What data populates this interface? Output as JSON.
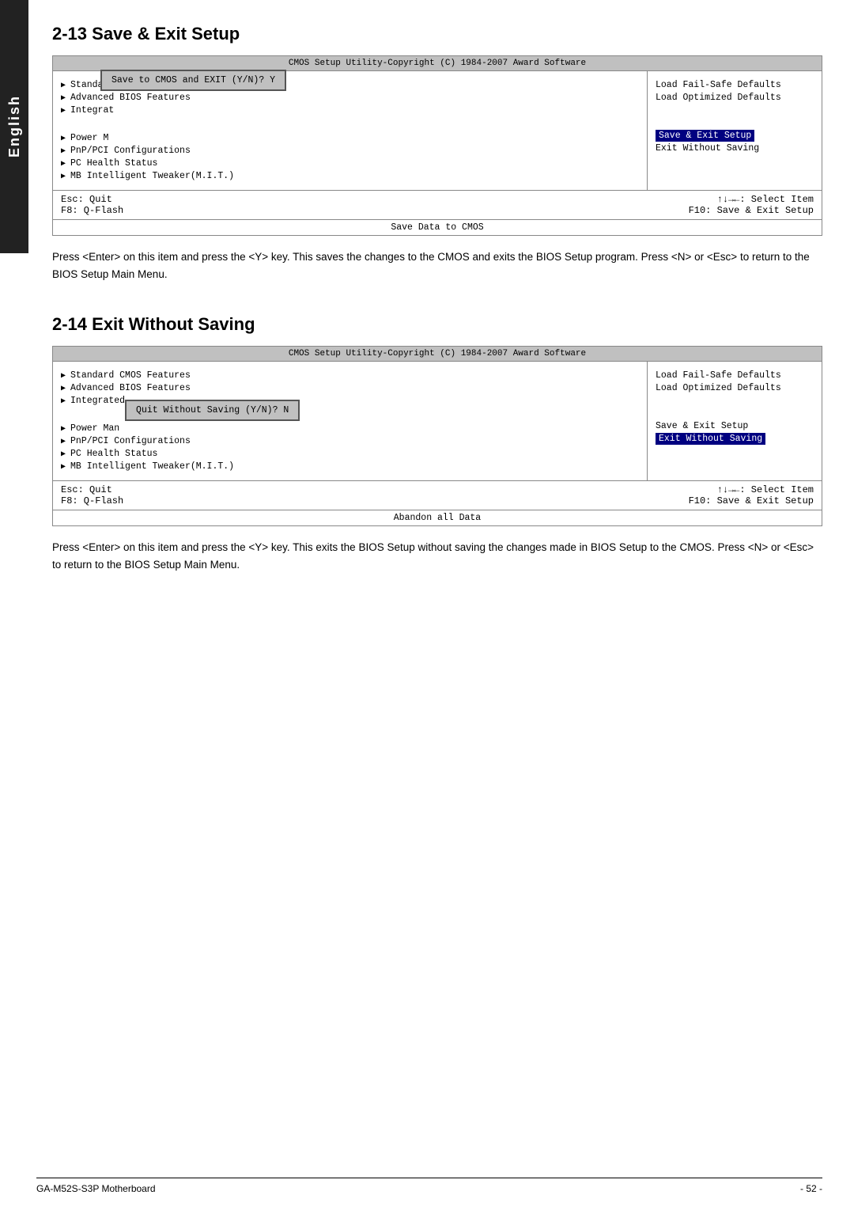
{
  "sidebar": {
    "label": "English"
  },
  "section1": {
    "heading": "2-13  Save & Exit Setup",
    "bios": {
      "title": "CMOS Setup Utility-Copyright (C) 1984-2007 Award Software",
      "left_items": [
        "Standard CMOS Features",
        "Advanced BIOS Features",
        "Integrated",
        "Power M",
        "PnP/PCI Configurations",
        "PC Health Status",
        "MB Intelligent Tweaker(M.I.T.)"
      ],
      "right_items": [
        "Load Fail-Safe Defaults",
        "Load Optimized Defaults",
        "",
        "",
        "Save & Exit Setup",
        "Exit Without Saving"
      ],
      "dialog_text": "Save to CMOS and EXIT (Y/N)? Y",
      "footer_left1": "Esc: Quit",
      "footer_left2": "F8: Q-Flash",
      "footer_right1": "↑↓→←: Select Item",
      "footer_right2": "F10: Save & Exit Setup",
      "status_bar": "Save Data to CMOS"
    },
    "description": "Press <Enter> on this item and press the <Y> key. This saves the changes to the CMOS and exits the BIOS Setup program. Press <N> or <Esc> to return to the BIOS Setup Main Menu."
  },
  "section2": {
    "heading": "2-14  Exit Without Saving",
    "bios": {
      "title": "CMOS Setup Utility-Copyright (C) 1984-2007 Award Software",
      "left_items": [
        "Standard CMOS Features",
        "Advanced BIOS Features",
        "Integrated",
        "Power Man",
        "PnP/PCI Configurations",
        "PC Health Status",
        "MB Intelligent Tweaker(M.I.T.)"
      ],
      "right_items": [
        "Load Fail-Safe Defaults",
        "Load Optimized Defaults",
        "...",
        "",
        "Save & Exit Setup",
        "Exit Without Saving"
      ],
      "dialog_text": "Quit Without Saving (Y/N)? N",
      "footer_left1": "Esc: Quit",
      "footer_left2": "F8: Q-Flash",
      "footer_right1": "↑↓→←: Select Item",
      "footer_right2": "F10: Save & Exit Setup",
      "status_bar": "Abandon all Data"
    },
    "description": "Press <Enter> on this item and press the <Y> key. This exits the BIOS Setup without saving the changes made in BIOS Setup to the CMOS. Press <N> or <Esc> to return to the BIOS Setup Main Menu."
  },
  "footer": {
    "left": "GA-M52S-S3P Motherboard",
    "right": "- 52 -"
  }
}
